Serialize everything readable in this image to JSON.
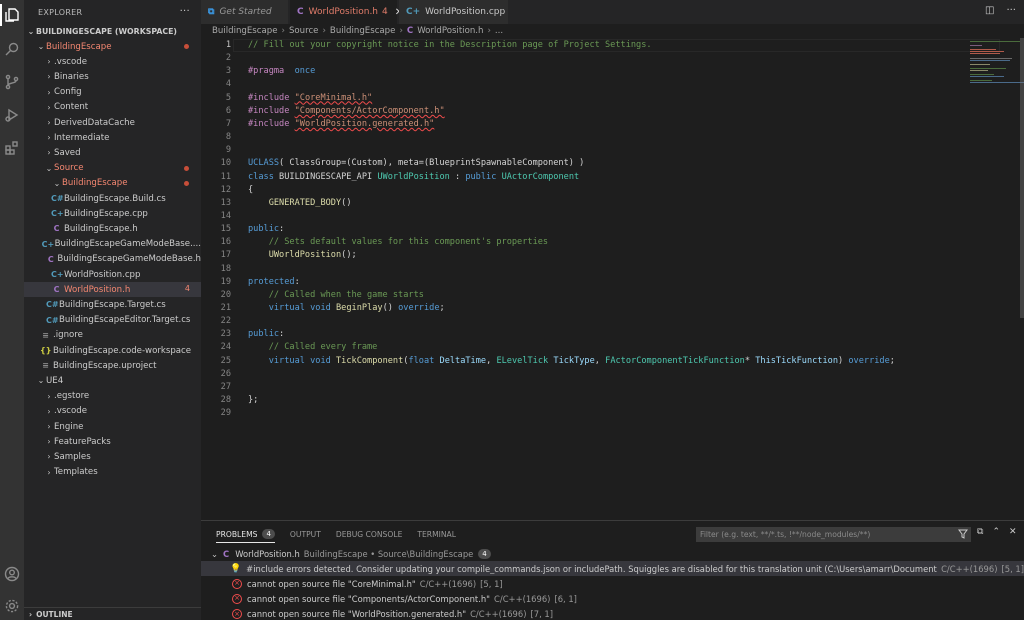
{
  "sidebar": {
    "title": "EXPLORER",
    "more": "···",
    "workspace": "BUILDINGESCAPE (WORKSPACE)",
    "items": [
      {
        "label": "BuildingEscape",
        "icon": "",
        "chev": "⌄",
        "red": true,
        "dot": true,
        "count": ""
      },
      {
        "label": ".vscode",
        "icon": "",
        "chev": "›",
        "red": false,
        "dot": false,
        "count": ""
      },
      {
        "label": "Binaries",
        "icon": "",
        "chev": "›",
        "red": false,
        "dot": false,
        "count": ""
      },
      {
        "label": "Config",
        "icon": "",
        "chev": "›",
        "red": false,
        "dot": false,
        "count": ""
      },
      {
        "label": "Content",
        "icon": "",
        "chev": "›",
        "red": false,
        "dot": false,
        "count": ""
      },
      {
        "label": "DerivedDataCache",
        "icon": "",
        "chev": "›",
        "red": false,
        "dot": false,
        "count": ""
      },
      {
        "label": "Intermediate",
        "icon": "",
        "chev": "›",
        "red": false,
        "dot": false,
        "count": ""
      },
      {
        "label": "Saved",
        "icon": "",
        "chev": "›",
        "red": false,
        "dot": false,
        "count": ""
      },
      {
        "label": "Source",
        "icon": "",
        "chev": "⌄",
        "red": true,
        "dot": true,
        "count": ""
      },
      {
        "label": "BuildingEscape",
        "icon": "",
        "chev": "⌄",
        "red": true,
        "dot": true,
        "count": ""
      },
      {
        "label": "BuildingEscape.Build.cs",
        "icon": "C#",
        "chev": "",
        "red": false,
        "dot": false,
        "count": ""
      },
      {
        "label": "BuildingEscape.cpp",
        "icon": "C+",
        "chev": "",
        "red": false,
        "dot": false,
        "count": ""
      },
      {
        "label": "BuildingEscape.h",
        "icon": "C",
        "chev": "",
        "red": false,
        "dot": false,
        "count": ""
      },
      {
        "label": "BuildingEscapeGameModeBase....",
        "icon": "C+",
        "chev": "",
        "red": false,
        "dot": false,
        "count": ""
      },
      {
        "label": "BuildingEscapeGameModeBase.h",
        "icon": "C",
        "chev": "",
        "red": false,
        "dot": false,
        "count": ""
      },
      {
        "label": "WorldPosition.cpp",
        "icon": "C+",
        "chev": "",
        "red": false,
        "dot": false,
        "count": ""
      },
      {
        "label": "WorldPosition.h",
        "icon": "C",
        "chev": "",
        "red": true,
        "dot": false,
        "count": "4"
      },
      {
        "label": "BuildingEscape.Target.cs",
        "icon": "C#",
        "chev": "",
        "red": false,
        "dot": false,
        "count": ""
      },
      {
        "label": "BuildingEscapeEditor.Target.cs",
        "icon": "C#",
        "chev": "",
        "red": false,
        "dot": false,
        "count": ""
      },
      {
        "label": ".ignore",
        "icon": "≡",
        "chev": "",
        "red": false,
        "dot": false,
        "count": ""
      },
      {
        "label": "BuildingEscape.code-workspace",
        "icon": "{}",
        "chev": "",
        "red": false,
        "dot": false,
        "count": ""
      },
      {
        "label": "BuildingEscape.uproject",
        "icon": "≡",
        "chev": "",
        "red": false,
        "dot": false,
        "count": ""
      },
      {
        "label": "UE4",
        "icon": "",
        "chev": "⌄",
        "red": false,
        "dot": false,
        "count": ""
      },
      {
        "label": ".egstore",
        "icon": "",
        "chev": "›",
        "red": false,
        "dot": false,
        "count": ""
      },
      {
        "label": ".vscode",
        "icon": "",
        "chev": "›",
        "red": false,
        "dot": false,
        "count": ""
      },
      {
        "label": "Engine",
        "icon": "",
        "chev": "›",
        "red": false,
        "dot": false,
        "count": ""
      },
      {
        "label": "FeaturePacks",
        "icon": "",
        "chev": "›",
        "red": false,
        "dot": false,
        "count": ""
      },
      {
        "label": "Samples",
        "icon": "",
        "chev": "›",
        "red": false,
        "dot": false,
        "count": ""
      },
      {
        "label": "Templates",
        "icon": "",
        "chev": "›",
        "red": false,
        "dot": false,
        "count": ""
      }
    ],
    "outline": "OUTLINE"
  },
  "tabs": [
    {
      "label": "Get Started",
      "icon": "⧉",
      "italic": true,
      "active": false,
      "badge": ""
    },
    {
      "label": "WorldPosition.h",
      "icon": "C",
      "italic": false,
      "active": true,
      "badge": "4"
    },
    {
      "label": "WorldPosition.cpp",
      "icon": "C+",
      "italic": false,
      "active": false,
      "badge": ""
    }
  ],
  "tab_actions": {
    "split": "◫",
    "more": "···"
  },
  "breadcrumb": [
    "BuildingEscape",
    "Source",
    "BuildingEscape",
    "WorldPosition.h",
    "..."
  ],
  "breadcrumb_icon": "C",
  "code_lines": [
    [
      [
        "cm",
        "// Fill out your copyright notice in the Description page of Project Settings."
      ]
    ],
    [],
    [
      [
        "pp",
        "#pragma"
      ],
      [
        "",
        "  "
      ],
      [
        "kw",
        "once"
      ]
    ],
    [],
    [
      [
        "pp",
        "#include"
      ],
      [
        "",
        " "
      ],
      [
        "st sq",
        "\"CoreMinimal.h\""
      ]
    ],
    [
      [
        "pp",
        "#include"
      ],
      [
        "",
        " "
      ],
      [
        "st sq",
        "\"Components/ActorComponent.h\""
      ]
    ],
    [
      [
        "pp",
        "#include"
      ],
      [
        "",
        " "
      ],
      [
        "st sq",
        "\"WorldPosition.generated.h\""
      ]
    ],
    [],
    [],
    [
      [
        "mc",
        "UCLASS"
      ],
      [
        "",
        "( ClassGroup=(Custom), meta=(BlueprintSpawnableComponent) )"
      ]
    ],
    [
      [
        "kw",
        "class"
      ],
      [
        "",
        " BUILDINGESCAPE_API "
      ],
      [
        "ty",
        "UWorldPosition"
      ],
      [
        "",
        " : "
      ],
      [
        "kw",
        "public"
      ],
      [
        "",
        " "
      ],
      [
        "ty",
        "UActorComponent"
      ]
    ],
    [
      [
        "",
        "{"
      ]
    ],
    [
      [
        "",
        "    "
      ],
      [
        "fn",
        "GENERATED_BODY"
      ],
      [
        "",
        "()"
      ]
    ],
    [],
    [
      [
        "kw",
        "public"
      ],
      [
        "",
        ":"
      ]
    ],
    [
      [
        "",
        "    "
      ],
      [
        "cm",
        "// Sets default values for this component's properties"
      ]
    ],
    [
      [
        "",
        "    "
      ],
      [
        "fn",
        "UWorldPosition"
      ],
      [
        "",
        "();"
      ]
    ],
    [],
    [
      [
        "kw",
        "protected"
      ],
      [
        "",
        ":"
      ]
    ],
    [
      [
        "",
        "    "
      ],
      [
        "cm",
        "// Called when the game starts"
      ]
    ],
    [
      [
        "",
        "    "
      ],
      [
        "kw",
        "virtual"
      ],
      [
        "",
        " "
      ],
      [
        "kw",
        "void"
      ],
      [
        "",
        " "
      ],
      [
        "fn",
        "BeginPlay"
      ],
      [
        "",
        "() "
      ],
      [
        "kw",
        "override"
      ],
      [
        "",
        ";"
      ]
    ],
    [],
    [
      [
        "kw",
        "public"
      ],
      [
        "",
        ":"
      ]
    ],
    [
      [
        "",
        "    "
      ],
      [
        "cm",
        "// Called every frame"
      ]
    ],
    [
      [
        "",
        "    "
      ],
      [
        "kw",
        "virtual"
      ],
      [
        "",
        " "
      ],
      [
        "kw",
        "void"
      ],
      [
        "",
        " "
      ],
      [
        "fn",
        "TickComponent"
      ],
      [
        "",
        "("
      ],
      [
        "kw",
        "float"
      ],
      [
        "",
        " "
      ],
      [
        "va",
        "DeltaTime"
      ],
      [
        "",
        ", "
      ],
      [
        "ty",
        "ELevelTick"
      ],
      [
        "",
        " "
      ],
      [
        "va",
        "TickType"
      ],
      [
        "",
        ", "
      ],
      [
        "ty",
        "FActorComponentTickFunction"
      ],
      [
        "",
        "* "
      ],
      [
        "va",
        "ThisTickFunction"
      ],
      [
        "",
        ") "
      ],
      [
        "kw",
        "override"
      ],
      [
        "",
        ";"
      ]
    ],
    [],
    [],
    [
      [
        "",
        "};"
      ]
    ],
    []
  ],
  "panel": {
    "tabs": [
      {
        "label": "PROBLEMS",
        "badge": "4",
        "active": true
      },
      {
        "label": "OUTPUT",
        "badge": "",
        "active": false
      },
      {
        "label": "DEBUG CONSOLE",
        "badge": "",
        "active": false
      },
      {
        "label": "TERMINAL",
        "badge": "",
        "active": false
      }
    ],
    "filter_placeholder": "Filter (e.g. text, **/*.ts, !**/node_modules/**)",
    "file": {
      "name": "WorldPosition.h",
      "path": "BuildingEscape • Source\\BuildingEscape",
      "count": "4"
    },
    "problems": [
      {
        "kind": "warn",
        "text": "#include errors detected. Consider updating your compile_commands.json or includePath. Squiggles are disabled for this translation unit (C:\\Users\\amarr\\Documents\\Unreal P...",
        "src": "C/C++(1696)",
        "loc": "[5, 1]"
      },
      {
        "kind": "err",
        "text": "cannot open source file \"CoreMinimal.h\"",
        "src": "C/C++(1696)",
        "loc": "[5, 1]"
      },
      {
        "kind": "err",
        "text": "cannot open source file \"Components/ActorComponent.h\"",
        "src": "C/C++(1696)",
        "loc": "[6, 1]"
      },
      {
        "kind": "err",
        "text": "cannot open source file \"WorldPosition.generated.h\"",
        "src": "C/C++(1696)",
        "loc": "[7, 1]"
      }
    ]
  }
}
